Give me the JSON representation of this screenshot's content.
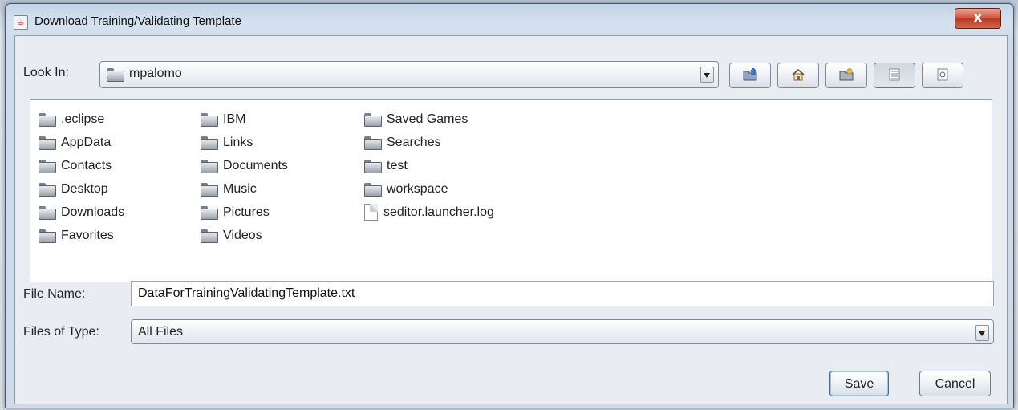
{
  "window": {
    "title": "Download Training/Validating Template",
    "close_label": "x",
    "app_icon": "java-coffee-icon"
  },
  "look_in": {
    "label": "Look In:",
    "value": "mpalomo"
  },
  "toolbar": {
    "buttons": [
      {
        "name": "up-one-level",
        "icon": "folder-up-icon"
      },
      {
        "name": "home",
        "icon": "home-icon"
      },
      {
        "name": "create-new-folder",
        "icon": "new-folder-icon"
      },
      {
        "name": "list-view",
        "icon": "list-view-icon",
        "pressed": true
      },
      {
        "name": "details-view",
        "icon": "details-view-icon",
        "pressed": false
      }
    ]
  },
  "files": {
    "columns": [
      [
        {
          "name": ".eclipse",
          "type": "folder"
        },
        {
          "name": "AppData",
          "type": "folder"
        },
        {
          "name": "Contacts",
          "type": "folder"
        },
        {
          "name": "Desktop",
          "type": "folder"
        },
        {
          "name": "Downloads",
          "type": "folder"
        },
        {
          "name": "Favorites",
          "type": "folder"
        }
      ],
      [
        {
          "name": "IBM",
          "type": "folder"
        },
        {
          "name": "Links",
          "type": "folder"
        },
        {
          "name": "Documents",
          "type": "folder"
        },
        {
          "name": "Music",
          "type": "folder"
        },
        {
          "name": "Pictures",
          "type": "folder"
        },
        {
          "name": "Videos",
          "type": "folder"
        }
      ],
      [
        {
          "name": "Saved Games",
          "type": "folder"
        },
        {
          "name": "Searches",
          "type": "folder"
        },
        {
          "name": "test",
          "type": "folder"
        },
        {
          "name": "workspace",
          "type": "folder"
        },
        {
          "name": "seditor.launcher.log",
          "type": "file"
        }
      ]
    ]
  },
  "file_name": {
    "label": "File Name:",
    "value": "DataForTrainingValidatingTemplate.txt"
  },
  "file_type": {
    "label": "Files of Type:",
    "value": "All Files"
  },
  "actions": {
    "save": "Save",
    "cancel": "Cancel"
  }
}
